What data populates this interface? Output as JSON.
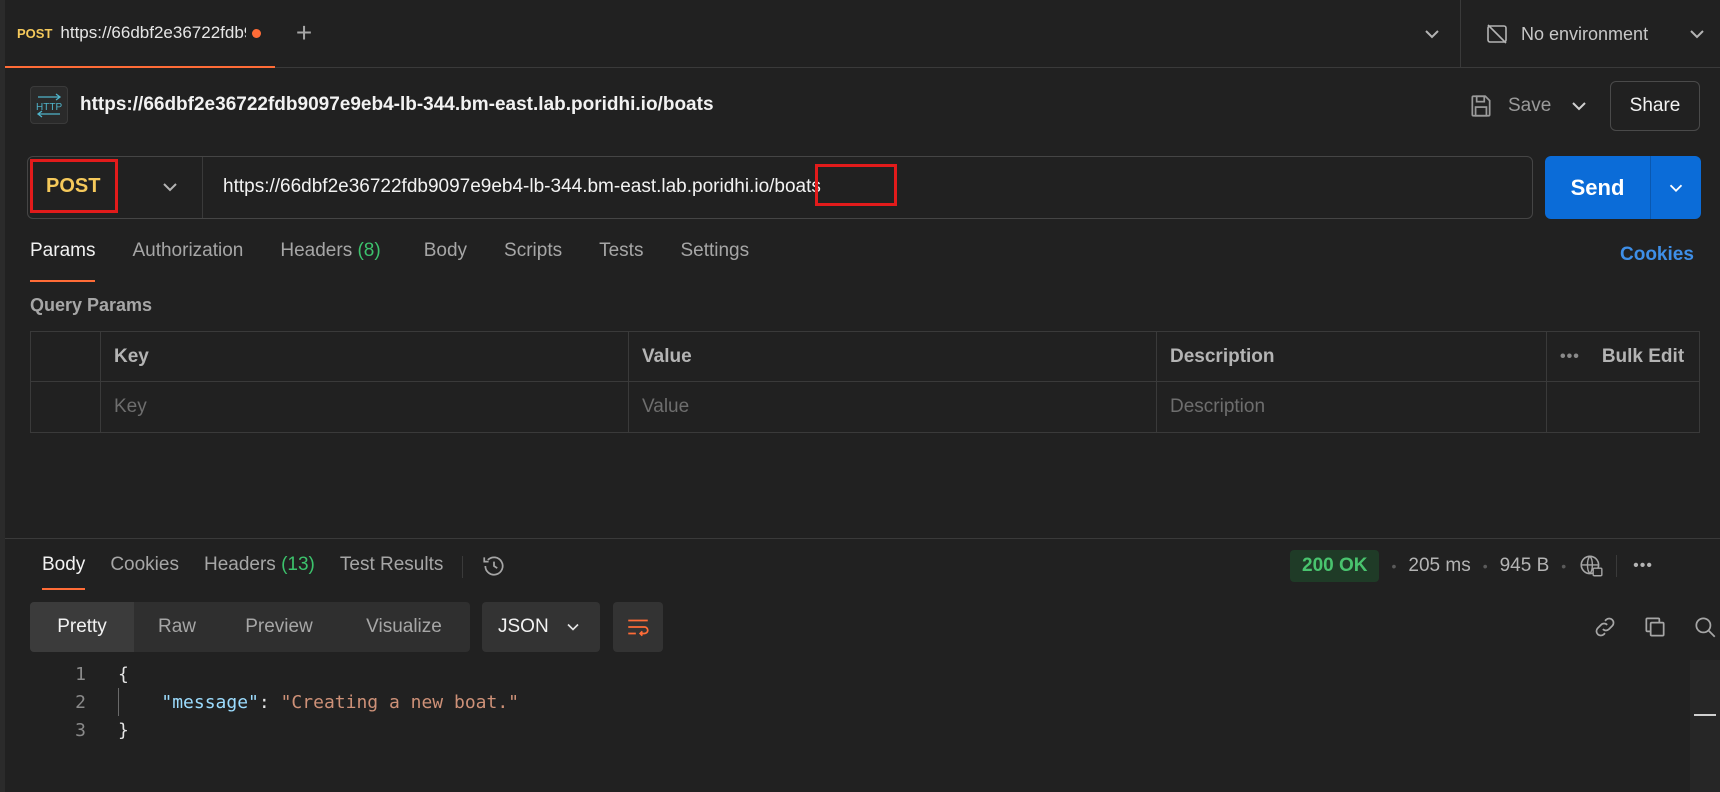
{
  "tab": {
    "method": "POST",
    "title": "https://66dbf2e36722fdb9097e9eb4-lb-344.bm-east.lab.poridhi.io/boats"
  },
  "environment": {
    "label": "No environment"
  },
  "request": {
    "title": "https://66dbf2e36722fdb9097e9eb4-lb-344.bm-east.lab.poridhi.io/boats",
    "save_label": "Save",
    "share_label": "Share",
    "method": "POST",
    "url_base": "https://66dbf2e36722fdb9097e9eb4-lb-344.bm-east.lab.poridhi.io",
    "url_path": "/boats",
    "send_label": "Send"
  },
  "request_tabs": [
    {
      "label": "Params"
    },
    {
      "label": "Authorization"
    },
    {
      "label": "Headers",
      "count": "(8)"
    },
    {
      "label": "Body"
    },
    {
      "label": "Scripts"
    },
    {
      "label": "Tests"
    },
    {
      "label": "Settings"
    }
  ],
  "cookies_link": "Cookies",
  "query_params": {
    "section_label": "Query Params",
    "headers": {
      "key": "Key",
      "value": "Value",
      "description": "Description",
      "bulk_edit": "Bulk Edit"
    },
    "placeholders": {
      "key": "Key",
      "value": "Value",
      "description": "Description"
    }
  },
  "response_tabs": [
    {
      "label": "Body"
    },
    {
      "label": "Cookies"
    },
    {
      "label": "Headers",
      "count": "(13)"
    },
    {
      "label": "Test Results"
    }
  ],
  "response_status": {
    "status": "200 OK",
    "time": "205 ms",
    "size": "945 B"
  },
  "format_options": [
    "Pretty",
    "Raw",
    "Preview",
    "Visualize"
  ],
  "format_selected": "JSON",
  "code_lines": [
    {
      "n": "1",
      "text": "{"
    },
    {
      "n": "2",
      "key": "\"message\"",
      "colon": ": ",
      "value": "\"Creating a new boat.\""
    },
    {
      "n": "3",
      "text": "}"
    }
  ],
  "colors": {
    "accent": "#ff6c37",
    "send": "#0b6cd8",
    "method": "#f5c95b",
    "success": "#49c36e",
    "highlight_box": "#e21b1b"
  }
}
